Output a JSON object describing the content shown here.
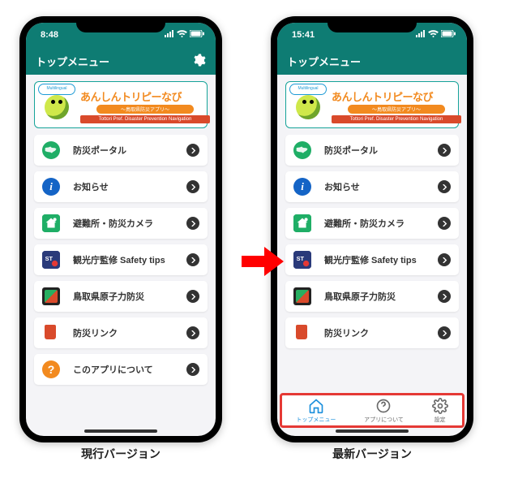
{
  "statusbar": {
    "left": {
      "time": "8:48"
    },
    "right": {
      "time": "15:41"
    }
  },
  "header": {
    "title": "トップメニュー"
  },
  "banner": {
    "multilingual": "Multilingual",
    "title": "あんしんトリピーなび",
    "subtitle": "～鳥取県防災アプリ～",
    "en": "Tottori Pref. Disaster Prevention Navigation"
  },
  "menu": {
    "items": [
      {
        "label": "防災ポータル",
        "icon": "globe-icon"
      },
      {
        "label": "お知らせ",
        "icon": "info-icon"
      },
      {
        "label": "避難所・防災カメラ",
        "icon": "shelter-icon"
      },
      {
        "label": "観光庁監修 Safety tips",
        "icon": "safetytips-icon"
      },
      {
        "label": "鳥取県原子力防災",
        "icon": "nuclear-icon"
      },
      {
        "label": "防災リンク",
        "icon": "bookmark-icon"
      },
      {
        "label": "このアプリについて",
        "icon": "about-icon"
      }
    ]
  },
  "tabbar": {
    "tabs": [
      {
        "label": "トップメニュー",
        "icon": "home-icon",
        "active": true
      },
      {
        "label": "アプリについて",
        "icon": "about-tab-icon",
        "active": false
      },
      {
        "label": "設定",
        "icon": "gear-tab-icon",
        "active": false
      }
    ]
  },
  "captions": {
    "left": "現行バージョン",
    "right": "最新バージョン"
  }
}
